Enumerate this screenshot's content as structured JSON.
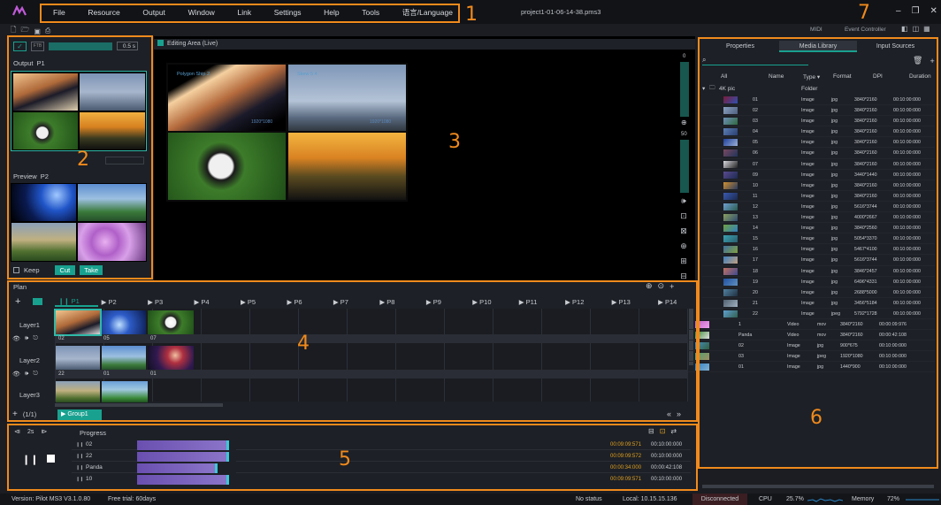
{
  "menu": {
    "items": [
      "File",
      "Resource",
      "Output",
      "Window",
      "Link",
      "Settings",
      "Help",
      "Tools",
      "语言/Language"
    ],
    "file_title": "project1-01-06-14-38.pms3"
  },
  "toolbar": {
    "midi": "MIDI",
    "event_controller": "Event Controller",
    "duration": "0.5 s",
    "fit": "FTB"
  },
  "output": {
    "title": "Output",
    "slot": "P1"
  },
  "preview": {
    "title": "Preview",
    "slot": "P2",
    "keep": "Keep",
    "cut": "Cut",
    "take": "Take"
  },
  "editing": {
    "title": "Editing Area (Live)",
    "labels": [
      "Polygon Ship 2",
      "Skew 5 4",
      "1920*1080",
      "1920*1080"
    ]
  },
  "right_tools": {
    "scale_top": "0",
    "scale_mid": "50"
  },
  "plan": {
    "title": "Plan",
    "pages": [
      "P1",
      "P2",
      "P3",
      "P4",
      "P5",
      "P6",
      "P7",
      "P8",
      "P9",
      "P10",
      "P11",
      "P12",
      "P13",
      "P14"
    ],
    "layers": [
      {
        "name": "Layer1",
        "items": [
          "02",
          "05",
          "07"
        ]
      },
      {
        "name": "Layer2",
        "items": [
          "22",
          "01",
          "01"
        ]
      },
      {
        "name": "Layer3",
        "items": []
      }
    ],
    "page_count": "(1/1)",
    "group": "Group1"
  },
  "progress": {
    "title": "Progress",
    "step": "2s",
    "rows": [
      {
        "name": "02",
        "pos": "00:09:09:571",
        "dur": "00:10:00:000",
        "fill": 0.93
      },
      {
        "name": "22",
        "pos": "00:09:09:572",
        "dur": "00:10:00:000",
        "fill": 0.93
      },
      {
        "name": "Panda",
        "pos": "00:00:34:000",
        "dur": "00:00:42:108",
        "fill": 0.81
      },
      {
        "name": "10",
        "pos": "00:09:09:571",
        "dur": "00:10:00:000",
        "fill": 0.93
      }
    ]
  },
  "library": {
    "tabs": [
      "Properties",
      "Media Library",
      "Input Sources"
    ],
    "columns": [
      "All",
      "Name",
      "Type",
      "Format",
      "DPI",
      "Duration"
    ],
    "folder": "4K pic",
    "folder_type": "Folder",
    "rows": [
      {
        "name": "01",
        "type": "Image",
        "format": "jpg",
        "dpi": "3840*2160",
        "dur": "00:10:00:000",
        "c1": "#7a1c3a",
        "c2": "#3050b0"
      },
      {
        "name": "02",
        "type": "Image",
        "format": "jpg",
        "dpi": "3840*2160",
        "dur": "00:10:00:000",
        "c1": "#8aa0c0",
        "c2": "#506080"
      },
      {
        "name": "03",
        "type": "Image",
        "format": "jpg",
        "dpi": "3840*2160",
        "dur": "00:10:00:000",
        "c1": "#6f8fb8",
        "c2": "#2f6a40"
      },
      {
        "name": "04",
        "type": "Image",
        "format": "jpg",
        "dpi": "3840*2160",
        "dur": "00:10:00:000",
        "c1": "#5c7fb5",
        "c2": "#2a3e70"
      },
      {
        "name": "05",
        "type": "Image",
        "format": "jpg",
        "dpi": "3840*2160",
        "dur": "00:10:00:000",
        "c1": "#1f3f9a",
        "c2": "#9ab0d8"
      },
      {
        "name": "06",
        "type": "Image",
        "format": "jpg",
        "dpi": "3840*2160",
        "dur": "00:10:00:000",
        "c1": "#7a4860",
        "c2": "#20345a"
      },
      {
        "name": "07",
        "type": "Image",
        "format": "jpg",
        "dpi": "3840*2160",
        "dur": "00:10:00:000",
        "c1": "#d8d8e0",
        "c2": "#222"
      },
      {
        "name": "09",
        "type": "Image",
        "format": "jpg",
        "dpi": "3440*1440",
        "dur": "00:10:00:000",
        "c1": "#5a4a90",
        "c2": "#1c2a50"
      },
      {
        "name": "10",
        "type": "Image",
        "format": "jpg",
        "dpi": "3840*2160",
        "dur": "00:10:00:000",
        "c1": "#d09030",
        "c2": "#2a3a60"
      },
      {
        "name": "11",
        "type": "Image",
        "format": "jpg",
        "dpi": "3840*2160",
        "dur": "00:10:00:000",
        "c1": "#3a5ab0",
        "c2": "#1a2a50"
      },
      {
        "name": "12",
        "type": "Image",
        "format": "jpg",
        "dpi": "5616*3744",
        "dur": "00:10:00:000",
        "c1": "#6fa0d0",
        "c2": "#2a5a50"
      },
      {
        "name": "13",
        "type": "Image",
        "format": "jpg",
        "dpi": "4000*2667",
        "dur": "00:10:00:000",
        "c1": "#8aa060",
        "c2": "#304a70"
      },
      {
        "name": "14",
        "type": "Image",
        "format": "jpg",
        "dpi": "3840*2560",
        "dur": "00:10:00:000",
        "c1": "#70a040",
        "c2": "#3080c0"
      },
      {
        "name": "15",
        "type": "Image",
        "format": "jpg",
        "dpi": "5054*3370",
        "dur": "00:10:00:000",
        "c1": "#3aa0b0",
        "c2": "#2a6070"
      },
      {
        "name": "16",
        "type": "Image",
        "format": "jpg",
        "dpi": "5467*4100",
        "dur": "00:10:00:000",
        "c1": "#4070a0",
        "c2": "#80a040"
      },
      {
        "name": "17",
        "type": "Image",
        "format": "jpg",
        "dpi": "5616*3744",
        "dur": "00:10:00:000",
        "c1": "#4080c0",
        "c2": "#c0a080"
      },
      {
        "name": "18",
        "type": "Image",
        "format": "jpg",
        "dpi": "3846*2457",
        "dur": "00:10:00:000",
        "c1": "#c07060",
        "c2": "#404a90"
      },
      {
        "name": "19",
        "type": "Image",
        "format": "jpg",
        "dpi": "6496*4331",
        "dur": "00:10:00:000",
        "c1": "#2050a0",
        "c2": "#6090c0"
      },
      {
        "name": "20",
        "type": "Image",
        "format": "jpg",
        "dpi": "2688*5000",
        "dur": "00:10:00:000",
        "c1": "#5080a0",
        "c2": "#203040"
      },
      {
        "name": "21",
        "type": "Image",
        "format": "jpg",
        "dpi": "3456*5184",
        "dur": "00:10:00:000",
        "c1": "#506070",
        "c2": "#a0b0c0"
      },
      {
        "name": "22",
        "type": "Image",
        "format": "jpeg",
        "dpi": "5792*1728",
        "dur": "00:10:00:000",
        "c1": "#60a0d0",
        "c2": "#306050"
      },
      {
        "name": "1",
        "type": "Video",
        "format": "mov",
        "dpi": "3840*2160",
        "dur": "00:00:09:976",
        "c1": "#c060c0",
        "c2": "#f0a0f0"
      },
      {
        "name": "Panda",
        "type": "Video",
        "format": "mov",
        "dpi": "3840*2160",
        "dur": "00:00:42:108",
        "c1": "#3a8a30",
        "c2": "#e0e0e0"
      },
      {
        "name": "02",
        "type": "Image",
        "format": "jpg",
        "dpi": "900*675",
        "dur": "00:10:00:000",
        "c1": "#4a90c0",
        "c2": "#306040"
      },
      {
        "name": "03",
        "type": "Image",
        "format": "jpeg",
        "dpi": "1920*1080",
        "dur": "00:10:00:000",
        "c1": "#50a070",
        "c2": "#a09060"
      },
      {
        "name": "01",
        "type": "Image",
        "format": "jpg",
        "dpi": "1440*900",
        "dur": "00:10:00:000",
        "c1": "#3080c0",
        "c2": "#80b0d0"
      }
    ]
  },
  "status": {
    "version": "Version: Pilot MS3 V3.1.0.80",
    "trial": "Free trial: 60days",
    "no_status": "No status",
    "local": "Local: 10.15.15.136",
    "disconnected": "Disconnected",
    "cpu_label": "CPU",
    "cpu": "25.7%",
    "mem_label": "Memory",
    "mem": "72%"
  },
  "callouts": [
    "1",
    "2",
    "3",
    "4",
    "5",
    "6",
    "7"
  ],
  "colors": {
    "accent": "#19a18f",
    "callout": "#f08a1c",
    "bg": "#1b1d22"
  }
}
